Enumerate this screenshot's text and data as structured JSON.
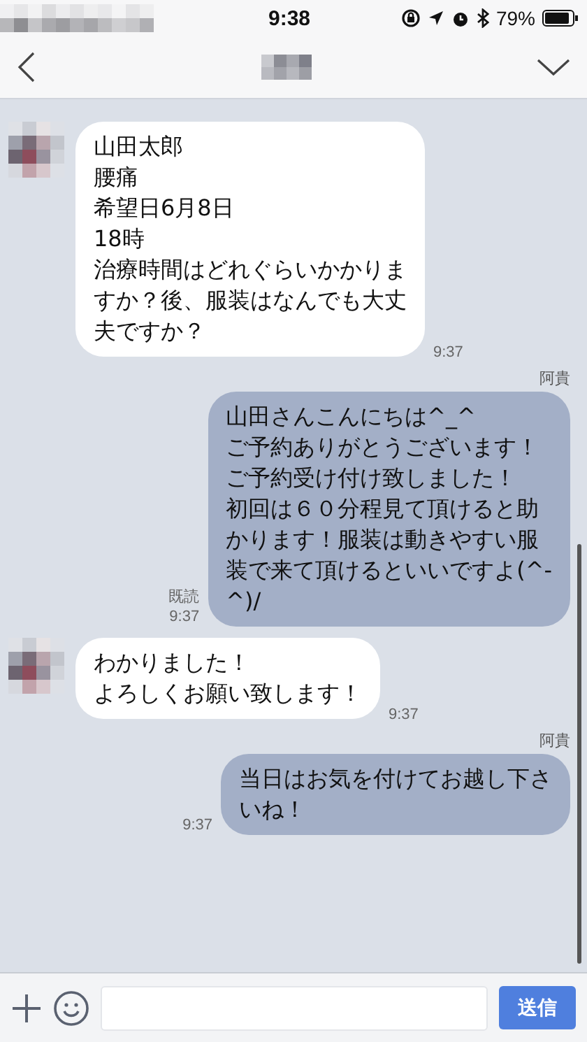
{
  "status_bar": {
    "time": "9:38",
    "battery": "79%"
  },
  "messages": [
    {
      "kind": "incoming",
      "lines": [
        "山田太郎",
        "腰痛",
        "希望日6月8日",
        "18時",
        "治療時間はどれぐらいかかりま",
        "すか？後、服装はなんでも大丈",
        "夫ですか？"
      ],
      "time": "9:37"
    },
    {
      "kind": "outgoing",
      "sender": "阿貴",
      "lines": [
        "山田さんこんにちは^_^",
        "ご予約ありがとうございます！",
        "ご予約受け付け致しました！",
        "初回は６０分程見て頂けると助",
        "かります！服装は動きやすい服",
        "装で来て頂けるといいですよ(^-",
        "^)/"
      ],
      "read_label": "既読",
      "time": "9:37"
    },
    {
      "kind": "incoming",
      "lines": [
        "わかりました！",
        "よろしくお願い致します！"
      ],
      "time": "9:37"
    },
    {
      "kind": "outgoing",
      "sender": "阿貴",
      "lines": [
        "当日はお気を付けてお越し下さ",
        "いね！"
      ],
      "time": "9:37"
    }
  ],
  "composer": {
    "send_button": "送信"
  }
}
